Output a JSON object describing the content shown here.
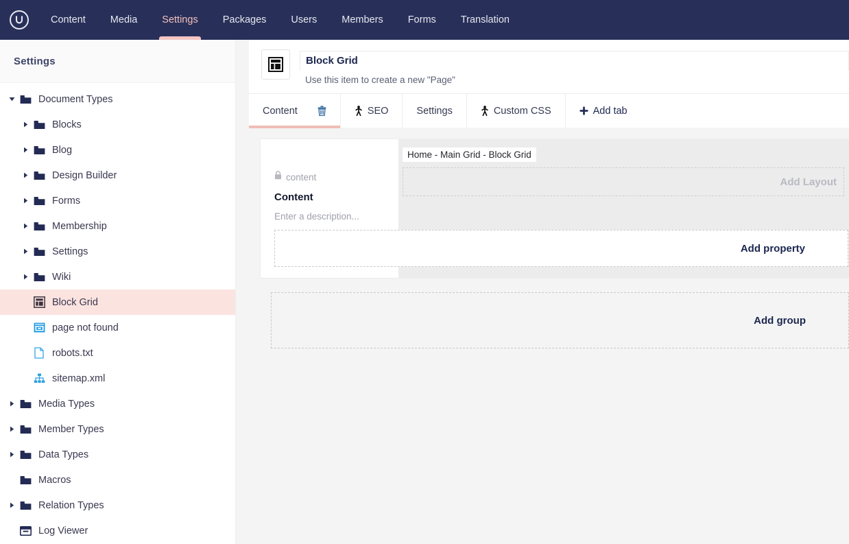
{
  "topnav": {
    "logo_icon": "umbraco-logo-icon",
    "items": [
      {
        "label": "Content",
        "active": false
      },
      {
        "label": "Media",
        "active": false
      },
      {
        "label": "Settings",
        "active": true
      },
      {
        "label": "Packages",
        "active": false
      },
      {
        "label": "Users",
        "active": false
      },
      {
        "label": "Members",
        "active": false
      },
      {
        "label": "Forms",
        "active": false
      },
      {
        "label": "Translation",
        "active": false
      }
    ]
  },
  "sidebar": {
    "title": "Settings",
    "tree": [
      {
        "label": "Document Types",
        "icon": "folder-icon",
        "depth": 0,
        "expanded": true,
        "caret": "down",
        "selected": false
      },
      {
        "label": "Blocks",
        "icon": "folder-icon",
        "depth": 1,
        "expanded": false,
        "caret": "right",
        "selected": false
      },
      {
        "label": "Blog",
        "icon": "folder-icon",
        "depth": 1,
        "expanded": false,
        "caret": "right",
        "selected": false
      },
      {
        "label": "Design Builder",
        "icon": "folder-icon",
        "depth": 1,
        "expanded": false,
        "caret": "right",
        "selected": false
      },
      {
        "label": "Forms",
        "icon": "folder-icon",
        "depth": 1,
        "expanded": false,
        "caret": "right",
        "selected": false
      },
      {
        "label": "Membership",
        "icon": "folder-icon",
        "depth": 1,
        "expanded": false,
        "caret": "right",
        "selected": false
      },
      {
        "label": "Settings",
        "icon": "folder-icon",
        "depth": 1,
        "expanded": false,
        "caret": "right",
        "selected": false
      },
      {
        "label": "Wiki",
        "icon": "folder-icon",
        "depth": 1,
        "expanded": false,
        "caret": "right",
        "selected": false
      },
      {
        "label": "Block Grid",
        "icon": "layout-grid-icon",
        "depth": 1,
        "expanded": false,
        "caret": "none",
        "selected": true
      },
      {
        "label": "page not found",
        "icon": "browser-window-error-icon",
        "depth": 1,
        "expanded": false,
        "caret": "none",
        "selected": false
      },
      {
        "label": "robots.txt",
        "icon": "document-icon",
        "depth": 1,
        "expanded": false,
        "caret": "none",
        "selected": false
      },
      {
        "label": "sitemap.xml",
        "icon": "sitemap-icon",
        "depth": 1,
        "expanded": false,
        "caret": "none",
        "selected": false
      },
      {
        "label": "Media Types",
        "icon": "folder-icon",
        "depth": 0,
        "expanded": false,
        "caret": "right",
        "selected": false
      },
      {
        "label": "Member Types",
        "icon": "folder-icon",
        "depth": 0,
        "expanded": false,
        "caret": "right",
        "selected": false
      },
      {
        "label": "Data Types",
        "icon": "folder-icon",
        "depth": 0,
        "expanded": false,
        "caret": "right",
        "selected": false
      },
      {
        "label": "Macros",
        "icon": "folder-icon",
        "depth": 0,
        "expanded": false,
        "caret": "none",
        "selected": false
      },
      {
        "label": "Relation Types",
        "icon": "folder-icon",
        "depth": 0,
        "expanded": false,
        "caret": "right",
        "selected": false
      },
      {
        "label": "Log Viewer",
        "icon": "log-viewer-icon",
        "depth": 0,
        "expanded": false,
        "caret": "none",
        "selected": false
      }
    ]
  },
  "document": {
    "icon": "layout-grid-icon",
    "name": "Block Grid",
    "description": "Use this item to create a new \"Page\"",
    "tabs": [
      {
        "label": "Content",
        "icon": "none",
        "active": true,
        "has_trash": true
      },
      {
        "label": "SEO",
        "icon": "inherited-icon",
        "active": false,
        "has_trash": false
      },
      {
        "label": "Settings",
        "icon": "none",
        "active": false,
        "has_trash": false
      },
      {
        "label": "Custom CSS",
        "icon": "inherited-icon",
        "active": false,
        "has_trash": false
      },
      {
        "label": "Add tab",
        "icon": "plus-icon",
        "active": false,
        "has_trash": false
      }
    ]
  },
  "group": {
    "lock_icon": "lock-icon",
    "alias": "content",
    "title": "Content",
    "description_placeholder": "Enter a description...",
    "property_chip": "Home - Main Grid - Block Grid",
    "add_layout_label": "Add Layout",
    "add_property_label": "Add property",
    "add_group_label": "Add group"
  },
  "colors": {
    "topnav_bg": "#28305a",
    "accent_pink": "#f5c5c2",
    "selected_row_bg": "#fbe3e0",
    "navy_text": "#1b264f",
    "panel_grey": "#ececec",
    "page_bg": "#f4f4f4"
  }
}
